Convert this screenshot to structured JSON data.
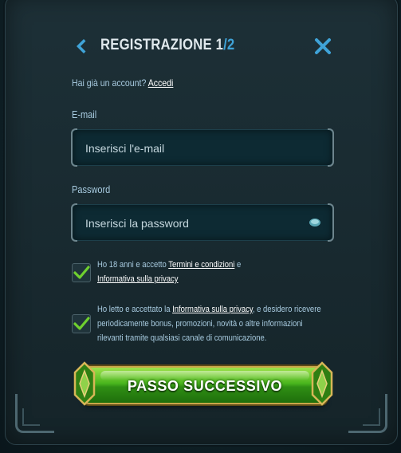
{
  "header": {
    "title": "REGISTRAZIONE",
    "step_current": "1",
    "step_separator": "/",
    "step_total": "2"
  },
  "login_prompt": {
    "text": "Hai già un account?",
    "link": "Accedi"
  },
  "email": {
    "label": "E-mail",
    "placeholder": "Inserisci l'e-mail",
    "value": ""
  },
  "password": {
    "label": "Password",
    "placeholder": "Inserisci la password",
    "value": ""
  },
  "consent_terms": {
    "checked": true,
    "text_1": "Ho 18 anni e accetto ",
    "link_1": "Termini e condizioni",
    "text_2": " e ",
    "link_2": "Informativa sulla privacy"
  },
  "consent_marketing": {
    "checked": true,
    "text_1": "Ho letto e accettato la ",
    "link_1": "Informativa sulla privacy",
    "text_2": ", e desidero ricevere periodicamente bonus, promozioni, novità o altre informazioni rilevanti tramite qualsiasi canale di comunicazione."
  },
  "cta": {
    "label": "PASSO SUCCESSIVO"
  },
  "icons": {
    "back": "chevron-left-icon",
    "close": "close-icon",
    "eye": "eye-icon",
    "check": "checkmark-icon"
  },
  "colors": {
    "accent_blue": "#3fa3d8",
    "label_blue": "#a8cbe0",
    "panel": "#1d3037",
    "button_green": "#49b51d",
    "button_gold": "#c9a64a",
    "check_green": "#6fcf2f"
  }
}
